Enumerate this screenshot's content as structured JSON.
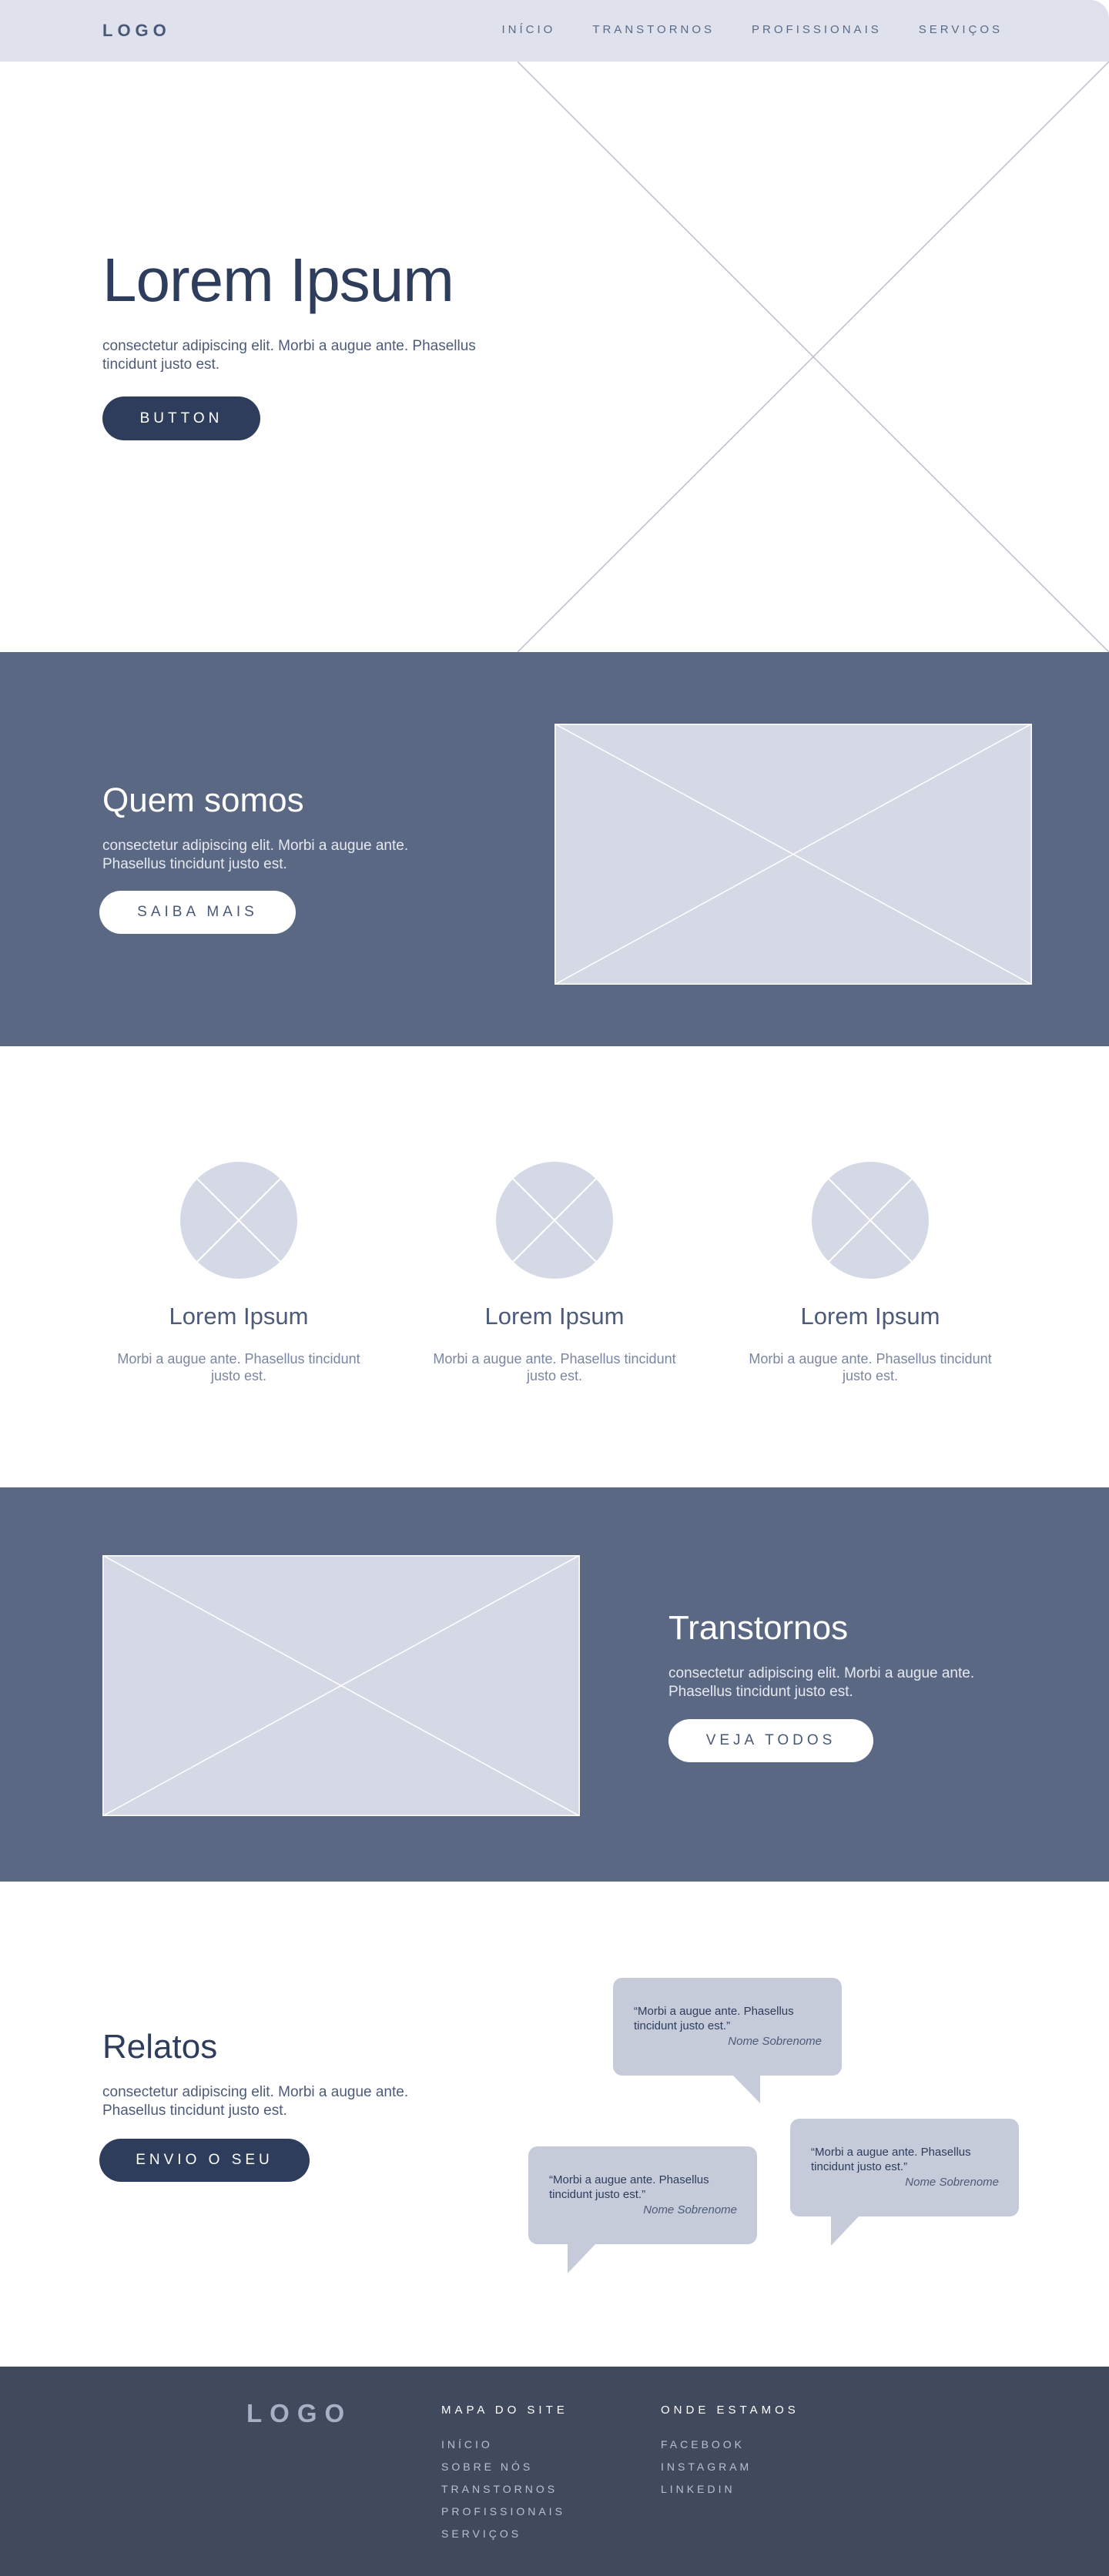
{
  "nav": {
    "logo": "LOGO",
    "items": [
      "INÍCIO",
      "TRANSTORNOS",
      "PROFISSIONAIS",
      "SERVIÇOS"
    ]
  },
  "hero": {
    "title": "Lorem Ipsum",
    "text": "consectetur adipiscing elit. Morbi a augue ante. Phasellus tincidunt justo est.",
    "button": "BUTTON"
  },
  "about": {
    "title": "Quem somos",
    "text": "consectetur adipiscing elit. Morbi a augue ante. Phasellus tincidunt justo est.",
    "button": "SAIBA MAIS"
  },
  "features": [
    {
      "title": "Lorem Ipsum",
      "text": "Morbi a augue ante. Phasellus tincidunt justo est."
    },
    {
      "title": "Lorem Ipsum",
      "text": "Morbi a augue ante. Phasellus tincidunt justo est."
    },
    {
      "title": "Lorem Ipsum",
      "text": "Morbi a augue ante. Phasellus tincidunt justo est."
    }
  ],
  "disorders": {
    "title": "Transtornos",
    "text": "consectetur adipiscing elit. Morbi a augue ante. Phasellus tincidunt justo est.",
    "button": "VEJA TODOS"
  },
  "testimonials": {
    "title": "Relatos",
    "text": "consectetur adipiscing elit. Morbi a augue ante. Phasellus tincidunt justo est.",
    "button": "ENVIO O SEU",
    "quotes": [
      {
        "quote": "“Morbi a augue ante. Phasellus tincidunt justo est.”",
        "name": "Nome Sobrenome"
      },
      {
        "quote": "“Morbi a augue ante. Phasellus tincidunt justo est.”",
        "name": "Nome Sobrenome"
      },
      {
        "quote": "“Morbi a augue ante. Phasellus tincidunt justo est.”",
        "name": "Nome Sobrenome"
      }
    ]
  },
  "footer": {
    "logo": "LOGO",
    "sitemap_title": "MAPA DO SITE",
    "sitemap": [
      "INÍCIO",
      "SOBRE NÓS",
      "TRANSTORNOS",
      "PROFISSIONAIS",
      "SERVIÇOS"
    ],
    "location_title": "ONDE ESTAMOS",
    "social": [
      "FACEBOOK",
      "INSTAGRAM",
      "LINKEDIN"
    ]
  },
  "colors": {
    "nav_bg": "#dfe2ec",
    "primary_dark": "#2e3d5c",
    "section_slate": "#5a6883",
    "placeholder": "#d4d9e5",
    "bubble": "#c5cbd9",
    "footer_bg": "#414a5c"
  }
}
